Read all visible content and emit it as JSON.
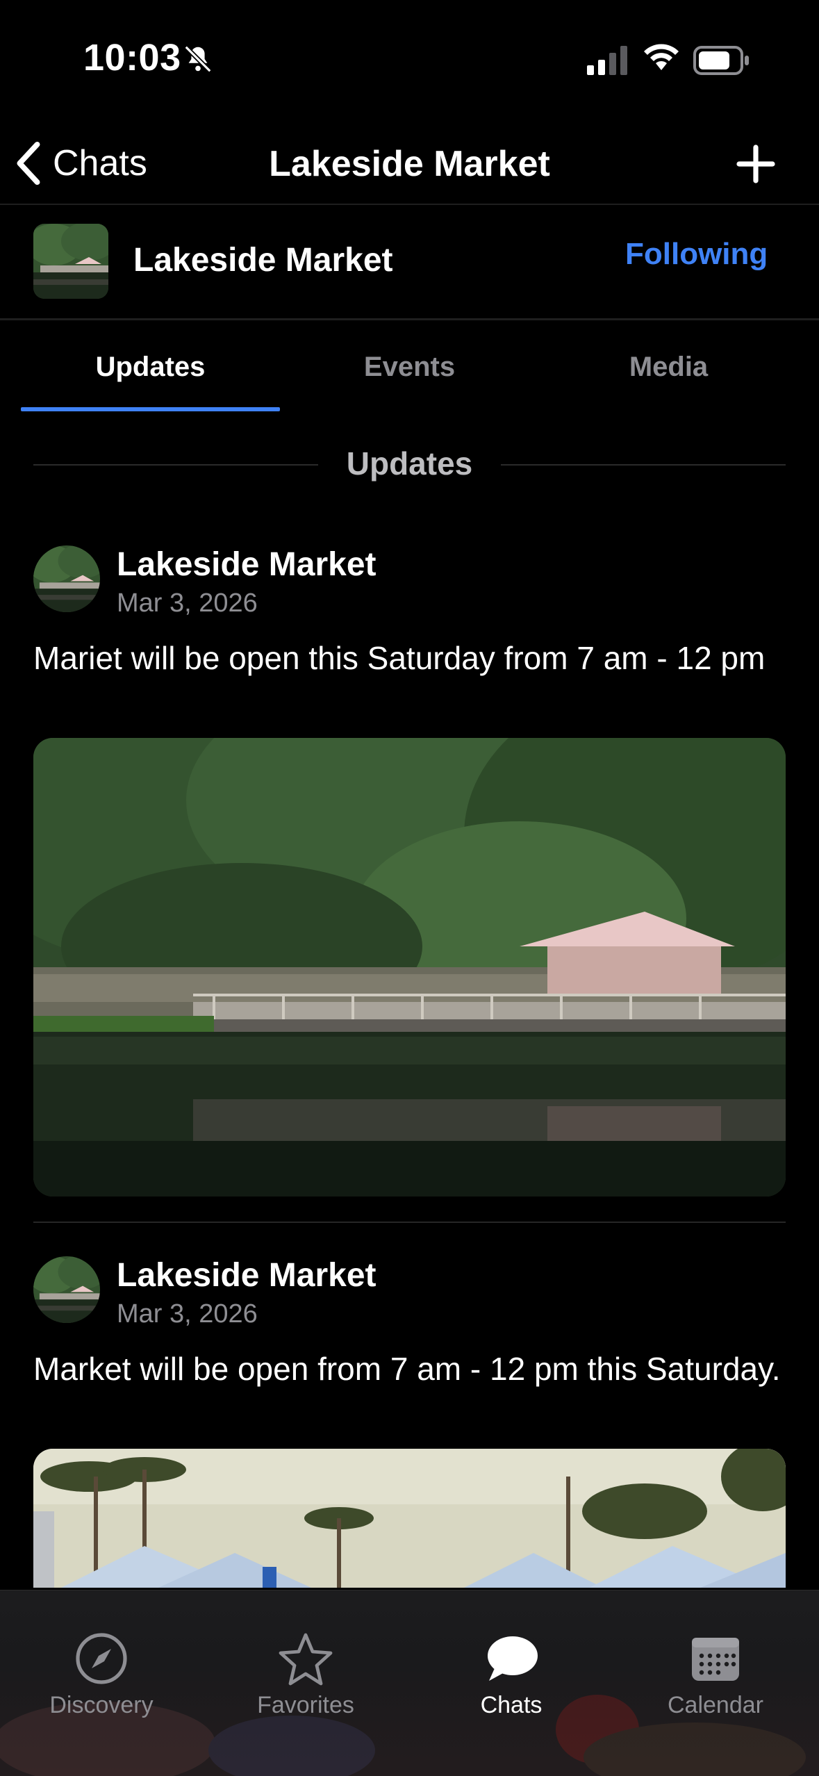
{
  "status_bar": {
    "time": "10:03",
    "icons": [
      "bell-slash-icon",
      "signal-icon",
      "wifi-icon",
      "battery-icon"
    ]
  },
  "nav": {
    "back_label": "Chats",
    "title": "Lakeside Market",
    "action_icon": "plus-icon"
  },
  "channel": {
    "name": "Lakeside Market",
    "follow_label": "Following",
    "follow_color": "#3f82f6"
  },
  "tabs": [
    {
      "label": "Updates",
      "active": true
    },
    {
      "label": "Events",
      "active": false
    },
    {
      "label": "Media",
      "active": false
    }
  ],
  "section_title": "Updates",
  "posts": [
    {
      "author": "Lakeside Market",
      "date": "Mar 3, 2026",
      "text": "Mariet will be open this Saturday from 7 am - 12 pm",
      "image": "market-lakeside-photo"
    },
    {
      "author": "Lakeside Market",
      "date": "Mar 3, 2026",
      "text": "Market will be open from 7 am - 12 pm this Saturday.",
      "image": "market-tents-palms-photo"
    }
  ],
  "tab_bar": [
    {
      "label": "Discovery",
      "icon": "compass-icon",
      "active": false
    },
    {
      "label": "Favorites",
      "icon": "star-icon",
      "active": false
    },
    {
      "label": "Chats",
      "icon": "chat-bubble-icon",
      "active": true
    },
    {
      "label": "Calendar",
      "icon": "calendar-icon",
      "active": false
    }
  ],
  "colors": {
    "background": "#000000",
    "accent": "#3f82f6",
    "secondary_text": "#8e8e93"
  }
}
